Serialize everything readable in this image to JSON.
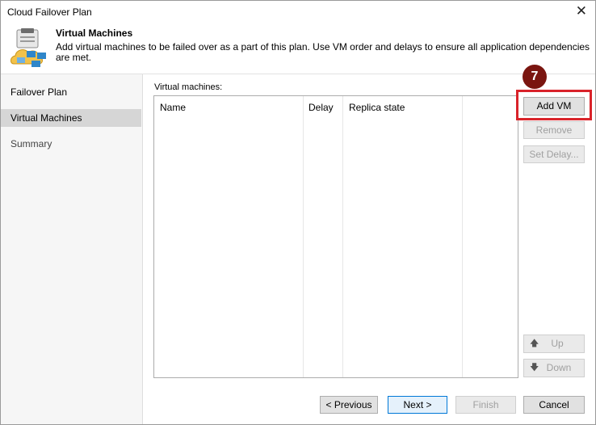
{
  "window": {
    "title": "Cloud Failover Plan",
    "close_glyph": "✕"
  },
  "header": {
    "title": "Virtual Machines",
    "description": "Add virtual machines to be failed over as a part of this plan. Use VM order and delays to ensure all application dependencies are met.",
    "icon": "cloud-vm-icon"
  },
  "sidebar": {
    "items": [
      {
        "label": "Failover Plan",
        "state": "normal"
      },
      {
        "label": "Virtual Machines",
        "state": "active"
      },
      {
        "label": "Summary",
        "state": "normal"
      }
    ]
  },
  "main": {
    "list_label": "Virtual machines:",
    "columns": [
      "Name",
      "Delay",
      "Replica state"
    ],
    "rows": []
  },
  "side_buttons": {
    "add_vm": "Add VM",
    "remove": "Remove",
    "set_delay": "Set Delay...",
    "up": "Up",
    "down": "Down",
    "up_arrow": "🡅",
    "down_arrow": "🡇"
  },
  "callout": {
    "number": "7",
    "color": "#d9232a"
  },
  "footer": {
    "previous": "< Previous",
    "next": "Next >",
    "finish": "Finish",
    "cancel": "Cancel"
  }
}
